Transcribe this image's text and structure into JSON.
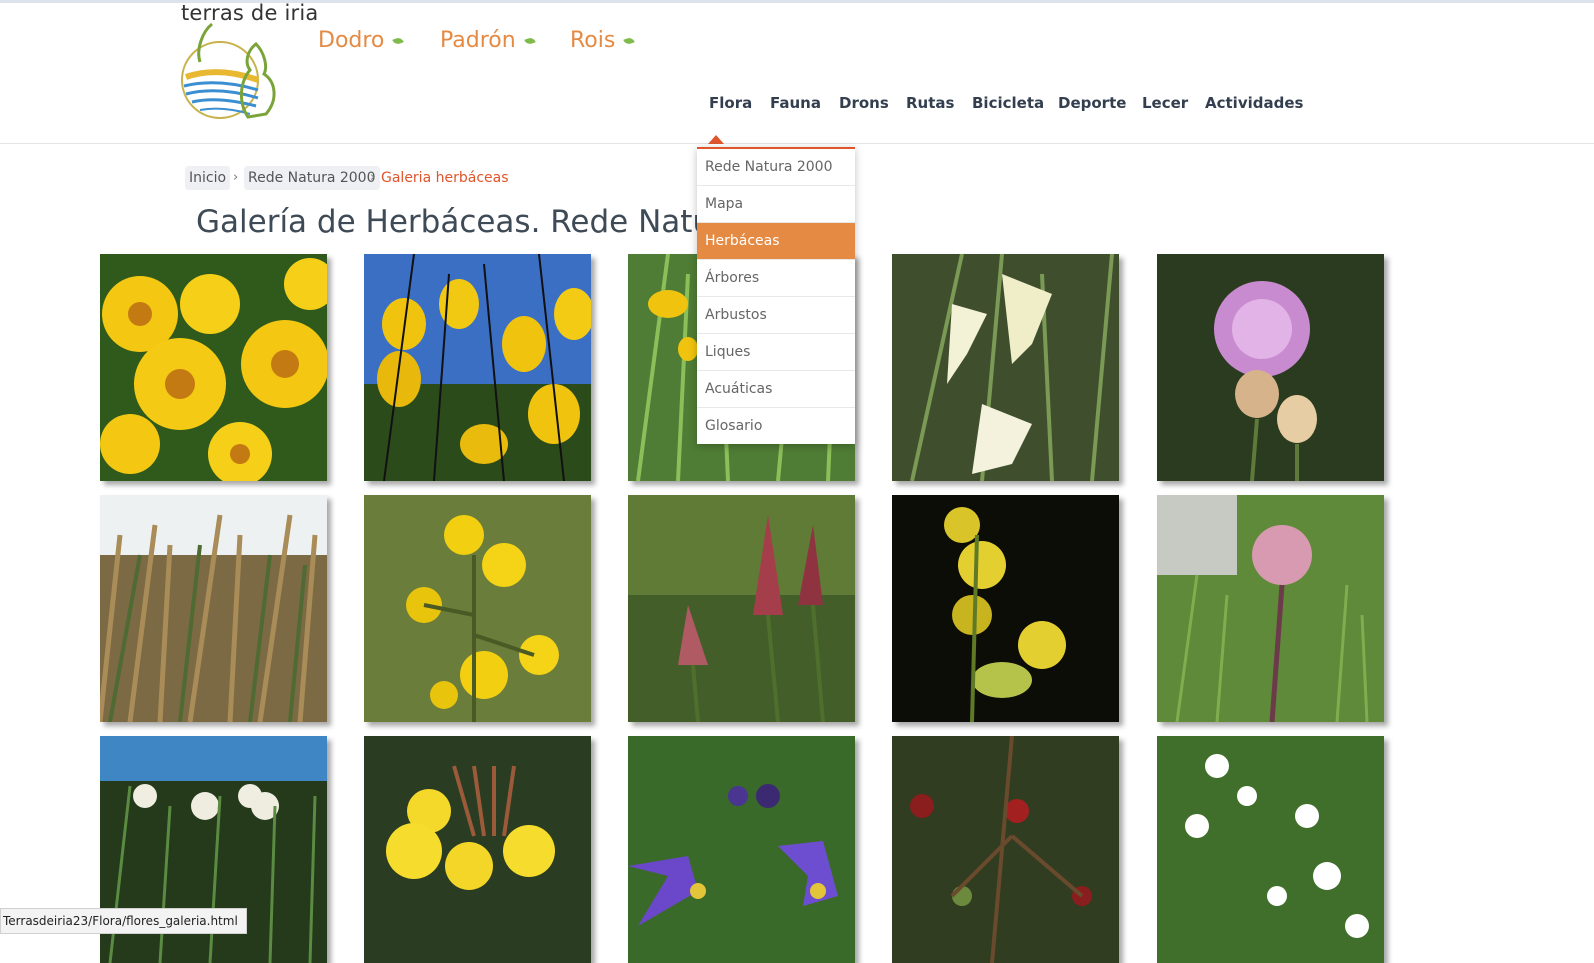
{
  "brand": {
    "logo_text": "terras de iria"
  },
  "top_nav": [
    {
      "label": "Dodro"
    },
    {
      "label": "Padrón"
    },
    {
      "label": "Rois"
    }
  ],
  "main_nav": [
    {
      "label": "Flora"
    },
    {
      "label": "Fauna"
    },
    {
      "label": "Drons"
    },
    {
      "label": "Rutas"
    },
    {
      "label": "Bicicleta"
    },
    {
      "label": "Deporte"
    },
    {
      "label": "Lecer"
    },
    {
      "label": "Actividades"
    }
  ],
  "breadcrumb": [
    {
      "label": "Inicio"
    },
    {
      "label": "Rede Natura 2000"
    },
    {
      "label": "Galeria herbáceas"
    }
  ],
  "page": {
    "title": "Galería de Herbáceas. Rede Natura 2000"
  },
  "flora_menu": [
    {
      "label": "Rede Natura 2000"
    },
    {
      "label": "Mapa"
    },
    {
      "label": "Herbáceas"
    },
    {
      "label": "Árbores"
    },
    {
      "label": "Arbustos"
    },
    {
      "label": "Liques"
    },
    {
      "label": "Acuáticas"
    },
    {
      "label": "Glosario"
    }
  ],
  "gallery": [
    "yellow-daisy-photo",
    "yellow-daffodils-photo",
    "yellow-narcissus-photo",
    "white-narcissus-photo",
    "pink-thistle-photo",
    "grass-meadow-photo",
    "st-johns-wort-photo",
    "tongue-orchid-photo",
    "yellow-meadow-rue-photo",
    "pink-valerian-photo",
    "white-meadowsweet-photo",
    "yellow-evening-primrose-photo",
    "purple-nightshade-photo",
    "red-figwort-photo",
    "white-bedstraw-photo"
  ],
  "status_bar": {
    "url": "Terrasdeiria23/Flora/flores_galeria.html"
  },
  "colors": {
    "accent": "#e58a43",
    "breadcrumb_current": "#e0552b",
    "nav_text": "#333f4f"
  }
}
